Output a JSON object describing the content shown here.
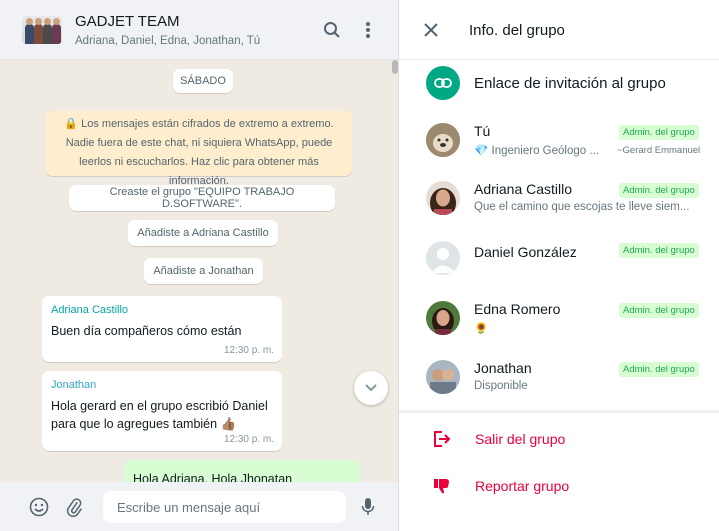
{
  "chat": {
    "group_name": "GADJET TEAM",
    "participants": "Adriana, Daniel, Edna, Jonathan, Tú",
    "day_label": "SÁBADO",
    "encryption_notice": "🔒 Los mensajes están cifrados de extremo a extremo. Nadie fuera de este chat, ni siquiera WhatsApp, puede leerlos ni escucharlos. Haz clic para obtener más información.",
    "system_messages": [
      "Creaste el grupo \"EQUIPO TRABAJO D.SOFTWARE\".",
      "Añadiste a Adriana Castillo",
      "Añadiste a Jonathan"
    ],
    "messages": [
      {
        "sender": "Adriana Castillo",
        "text": "Buen día compañeros cómo están",
        "time": "12:30 p. m."
      },
      {
        "sender": "Jonathan",
        "text": "Hola gerard en el grupo escribió Daniel para que lo agregues también 👍🏽",
        "time": "12:30 p. m."
      },
      {
        "outgoing_text": "Hola Adriana. Hola Jhonatan"
      }
    ],
    "composer_placeholder": "Escribe un mensaje aquí"
  },
  "info": {
    "title": "Info. del grupo",
    "invite_label": "Enlace de invitación al grupo",
    "members": [
      {
        "name": "Tú",
        "status": "💎 Ingeniero Geólogo ...",
        "badge": "Admin. del grupo",
        "pushname": "~Gerard Emmanuel"
      },
      {
        "name": "Adriana Castillo",
        "status": "Que el camino que escojas te lleve siem...",
        "badge": "Admin. del grupo"
      },
      {
        "name": "Daniel González",
        "status": "",
        "badge": "Admin. del grupo"
      },
      {
        "name": "Edna Romero",
        "status": "🌻",
        "badge": "Admin. del grupo"
      },
      {
        "name": "Jonathan",
        "status": "Disponible",
        "badge": "Admin. del grupo"
      }
    ],
    "exit_label": "Salir del grupo",
    "report_label": "Reportar grupo"
  },
  "colors": {
    "accent_green": "#00a884",
    "danger_red": "#ea0038",
    "outgoing_bubble": "#d9fdd3",
    "chat_bg": "#efeae2"
  }
}
